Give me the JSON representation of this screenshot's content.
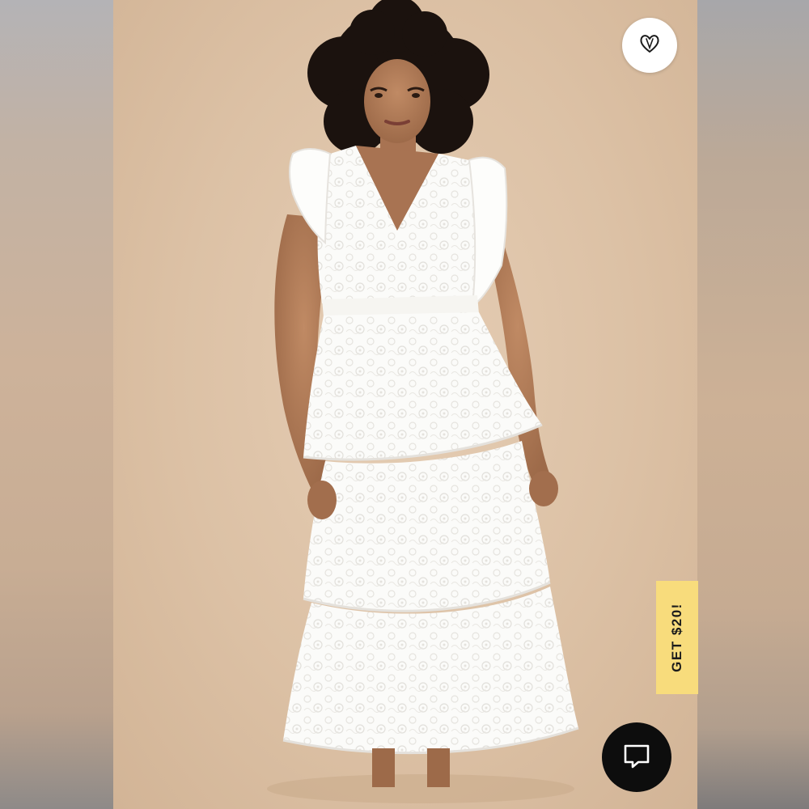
{
  "product_image": {
    "alt": "",
    "background_color": "#dcc1a5",
    "dress_color": "#ffffff"
  },
  "wishlist": {
    "icon": "heart-icon"
  },
  "promo": {
    "label": "GET $20!",
    "color": "#f8dc7c"
  },
  "chat": {
    "icon": "chat-bubble-icon",
    "color": "#0d0d0d"
  }
}
